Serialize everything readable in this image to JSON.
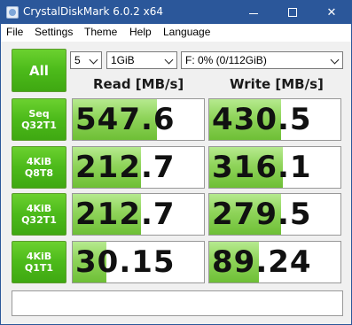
{
  "window": {
    "title": "CrystalDiskMark 6.0.2 x64"
  },
  "menu": [
    {
      "label": "File"
    },
    {
      "label": "Settings"
    },
    {
      "label": "Theme"
    },
    {
      "label": "Help"
    },
    {
      "label": "Language"
    }
  ],
  "controls": {
    "all_label": "All",
    "test_count": "5",
    "test_size": "1GiB",
    "drive": "F: 0% (0/112GiB)"
  },
  "headers": {
    "read": "Read [MB/s]",
    "write": "Write [MB/s]"
  },
  "rows": [
    {
      "line1": "Seq",
      "line2": "Q32T1",
      "read": "547.6",
      "write": "430.5",
      "read_fill_pct": 64,
      "write_fill_pct": 55
    },
    {
      "line1": "4KiB",
      "line2": "Q8T8",
      "read": "212.7",
      "write": "316.1",
      "read_fill_pct": 52,
      "write_fill_pct": 56
    },
    {
      "line1": "4KiB",
      "line2": "Q32T1",
      "read": "212.7",
      "write": "279.5",
      "read_fill_pct": 52,
      "write_fill_pct": 55
    },
    {
      "line1": "4KiB",
      "line2": "Q1T1",
      "read": "30.15",
      "write": "89.24",
      "read_fill_pct": 26,
      "write_fill_pct": 38
    }
  ],
  "comment": "",
  "colors": {
    "titlebar": "#2b579a",
    "button_green": "#4cba1a",
    "bar_green": "#8fd45a"
  },
  "icons": [
    "app-icon",
    "minimize-icon",
    "maximize-icon",
    "close-icon",
    "dropdown-arrow-icon"
  ]
}
